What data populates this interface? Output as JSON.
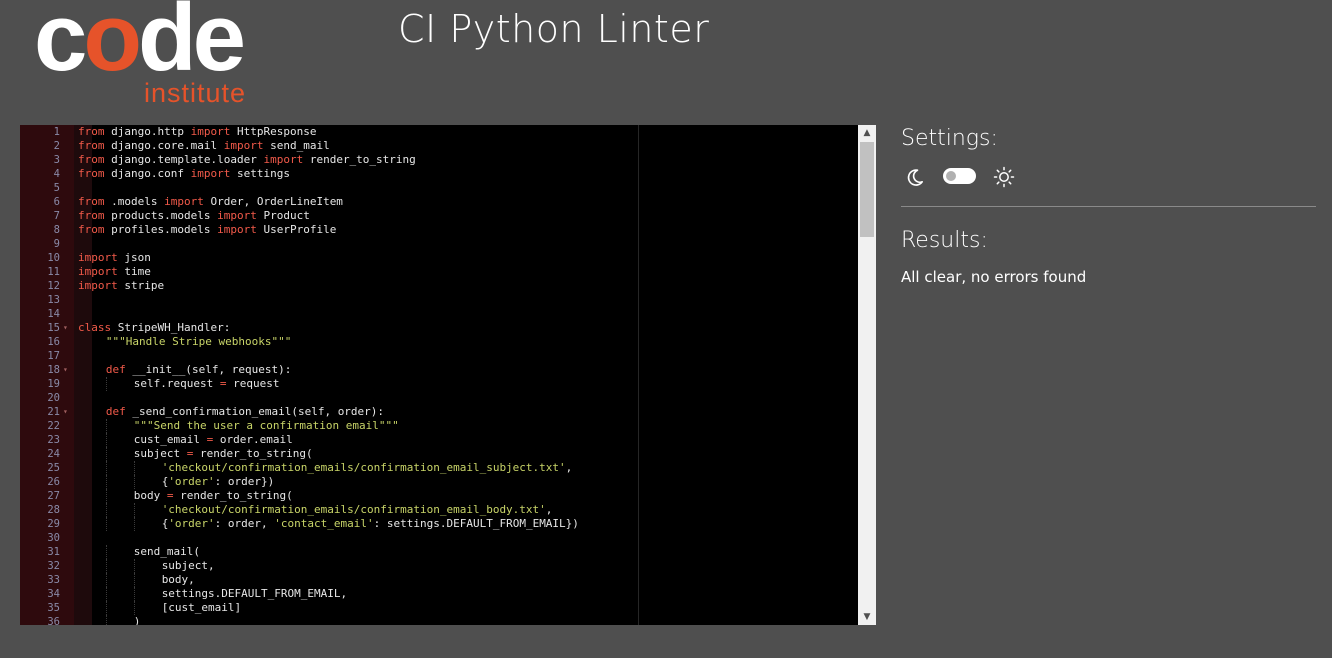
{
  "logo": {
    "word_part1": "c",
    "word_o": "o",
    "word_part2": "de",
    "subtitle": "institute",
    "accent_color": "#e6532a"
  },
  "header": {
    "title": "CI Python Linter"
  },
  "editor": {
    "lines": [
      {
        "n": "1",
        "fold": false,
        "indent": 0,
        "tokens": [
          [
            "kw",
            "from"
          ],
          [
            "t",
            " django.http "
          ],
          [
            "kw",
            "import"
          ],
          [
            "t",
            " HttpResponse"
          ]
        ]
      },
      {
        "n": "2",
        "fold": false,
        "indent": 0,
        "tokens": [
          [
            "kw",
            "from"
          ],
          [
            "t",
            " django.core.mail "
          ],
          [
            "kw",
            "import"
          ],
          [
            "t",
            " send_mail"
          ]
        ]
      },
      {
        "n": "3",
        "fold": false,
        "indent": 0,
        "tokens": [
          [
            "kw",
            "from"
          ],
          [
            "t",
            " django.template.loader "
          ],
          [
            "kw",
            "import"
          ],
          [
            "t",
            " render_to_string"
          ]
        ]
      },
      {
        "n": "4",
        "fold": false,
        "indent": 0,
        "tokens": [
          [
            "kw",
            "from"
          ],
          [
            "t",
            " django.conf "
          ],
          [
            "kw",
            "import"
          ],
          [
            "t",
            " settings"
          ]
        ]
      },
      {
        "n": "5",
        "fold": false,
        "indent": 0,
        "tokens": []
      },
      {
        "n": "6",
        "fold": false,
        "indent": 0,
        "tokens": [
          [
            "kw",
            "from"
          ],
          [
            "t",
            " .models "
          ],
          [
            "kw",
            "import"
          ],
          [
            "t",
            " Order, OrderLineItem"
          ]
        ]
      },
      {
        "n": "7",
        "fold": false,
        "indent": 0,
        "tokens": [
          [
            "kw",
            "from"
          ],
          [
            "t",
            " products.models "
          ],
          [
            "kw",
            "import"
          ],
          [
            "t",
            " Product"
          ]
        ]
      },
      {
        "n": "8",
        "fold": false,
        "indent": 0,
        "tokens": [
          [
            "kw",
            "from"
          ],
          [
            "t",
            " profiles.models "
          ],
          [
            "kw",
            "import"
          ],
          [
            "t",
            " UserProfile"
          ]
        ]
      },
      {
        "n": "9",
        "fold": false,
        "indent": 0,
        "tokens": []
      },
      {
        "n": "10",
        "fold": false,
        "indent": 0,
        "tokens": [
          [
            "kw",
            "import"
          ],
          [
            "t",
            " json"
          ]
        ]
      },
      {
        "n": "11",
        "fold": false,
        "indent": 0,
        "tokens": [
          [
            "kw",
            "import"
          ],
          [
            "t",
            " time"
          ]
        ]
      },
      {
        "n": "12",
        "fold": false,
        "indent": 0,
        "tokens": [
          [
            "kw",
            "import"
          ],
          [
            "t",
            " stripe"
          ]
        ]
      },
      {
        "n": "13",
        "fold": false,
        "indent": 0,
        "tokens": []
      },
      {
        "n": "14",
        "fold": false,
        "indent": 0,
        "tokens": []
      },
      {
        "n": "15",
        "fold": true,
        "indent": 0,
        "tokens": [
          [
            "kw",
            "class"
          ],
          [
            "t",
            " StripeWH_Handler:"
          ]
        ]
      },
      {
        "n": "16",
        "fold": false,
        "indent": 1,
        "tokens": [
          [
            "str",
            "\"\"\"Handle Stripe webhooks\"\"\""
          ]
        ]
      },
      {
        "n": "17",
        "fold": false,
        "indent": 0,
        "tokens": []
      },
      {
        "n": "18",
        "fold": true,
        "indent": 1,
        "tokens": [
          [
            "kw",
            "def"
          ],
          [
            "t",
            " __init__(self, request):"
          ]
        ]
      },
      {
        "n": "19",
        "fold": false,
        "indent": 2,
        "tokens": [
          [
            "t",
            "self.request "
          ],
          [
            "kw",
            "="
          ],
          [
            "t",
            " request"
          ]
        ]
      },
      {
        "n": "20",
        "fold": false,
        "indent": 0,
        "tokens": []
      },
      {
        "n": "21",
        "fold": true,
        "indent": 1,
        "tokens": [
          [
            "kw",
            "def"
          ],
          [
            "t",
            " _send_confirmation_email(self, order):"
          ]
        ]
      },
      {
        "n": "22",
        "fold": false,
        "indent": 2,
        "tokens": [
          [
            "str",
            "\"\"\"Send the user a confirmation email\"\"\""
          ]
        ]
      },
      {
        "n": "23",
        "fold": false,
        "indent": 2,
        "tokens": [
          [
            "t",
            "cust_email "
          ],
          [
            "kw",
            "="
          ],
          [
            "t",
            " order.email"
          ]
        ]
      },
      {
        "n": "24",
        "fold": false,
        "indent": 2,
        "tokens": [
          [
            "t",
            "subject "
          ],
          [
            "kw",
            "="
          ],
          [
            "t",
            " render_to_string("
          ]
        ]
      },
      {
        "n": "25",
        "fold": false,
        "indent": 3,
        "tokens": [
          [
            "str",
            "'checkout/confirmation_emails/confirmation_email_subject.txt'"
          ],
          [
            "t",
            ","
          ]
        ]
      },
      {
        "n": "26",
        "fold": false,
        "indent": 3,
        "tokens": [
          [
            "t",
            "{"
          ],
          [
            "str",
            "'order'"
          ],
          [
            "t",
            ": order})"
          ]
        ]
      },
      {
        "n": "27",
        "fold": false,
        "indent": 2,
        "tokens": [
          [
            "t",
            "body "
          ],
          [
            "kw",
            "="
          ],
          [
            "t",
            " render_to_string("
          ]
        ]
      },
      {
        "n": "28",
        "fold": false,
        "indent": 3,
        "tokens": [
          [
            "str",
            "'checkout/confirmation_emails/confirmation_email_body.txt'"
          ],
          [
            "t",
            ","
          ]
        ]
      },
      {
        "n": "29",
        "fold": false,
        "indent": 3,
        "tokens": [
          [
            "t",
            "{"
          ],
          [
            "str",
            "'order'"
          ],
          [
            "t",
            ": order, "
          ],
          [
            "str",
            "'contact_email'"
          ],
          [
            "t",
            ": settings.DEFAULT_FROM_EMAIL})"
          ]
        ]
      },
      {
        "n": "30",
        "fold": false,
        "indent": 0,
        "tokens": []
      },
      {
        "n": "31",
        "fold": false,
        "indent": 2,
        "tokens": [
          [
            "t",
            "send_mail("
          ]
        ]
      },
      {
        "n": "32",
        "fold": false,
        "indent": 3,
        "tokens": [
          [
            "t",
            "subject,"
          ]
        ]
      },
      {
        "n": "33",
        "fold": false,
        "indent": 3,
        "tokens": [
          [
            "t",
            "body,"
          ]
        ]
      },
      {
        "n": "34",
        "fold": false,
        "indent": 3,
        "tokens": [
          [
            "t",
            "settings.DEFAULT_FROM_EMAIL,"
          ]
        ]
      },
      {
        "n": "35",
        "fold": false,
        "indent": 3,
        "tokens": [
          [
            "t",
            "[cust_email]"
          ]
        ]
      },
      {
        "n": "36",
        "fold": false,
        "indent": 2,
        "tokens": [
          [
            "t",
            ")"
          ]
        ]
      }
    ]
  },
  "settings": {
    "title": "Settings:",
    "toggle_state": "off"
  },
  "results": {
    "title": "Results:",
    "message": "All clear, no errors found"
  }
}
